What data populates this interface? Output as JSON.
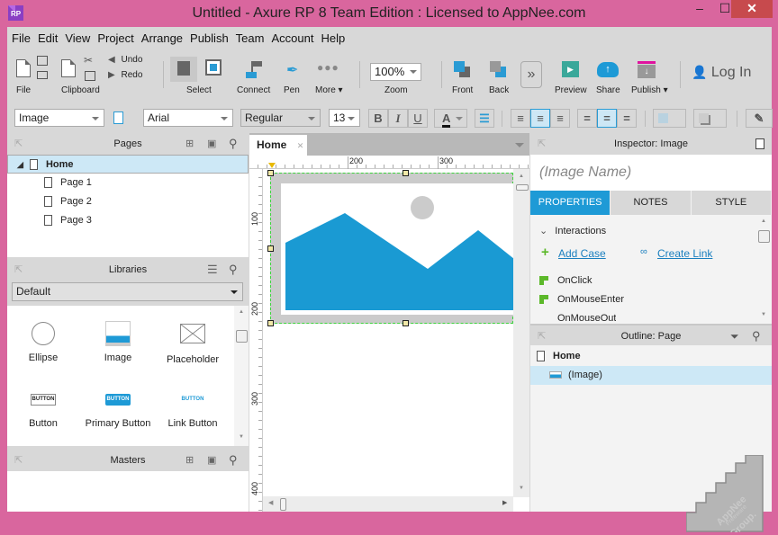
{
  "window": {
    "app_icon": "RP",
    "title": "Untitled - Axure RP 8 Team Edition : Licensed to AppNee.com",
    "minimize": "–",
    "maximize": "☐",
    "close": "✕"
  },
  "menu": [
    "File",
    "Edit",
    "View",
    "Project",
    "Arrange",
    "Publish",
    "Team",
    "Account",
    "Help"
  ],
  "toolbar": {
    "file": "File",
    "clipboard": "Clipboard",
    "undo": "Undo",
    "redo": "Redo",
    "select": "Select",
    "connect": "Connect",
    "pen": "Pen",
    "more": "More ▾",
    "zoom_value": "100%",
    "zoom": "Zoom",
    "front": "Front",
    "back": "Back",
    "overflow": "»",
    "preview": "Preview",
    "share": "Share",
    "publish": "Publish ▾",
    "login": "Log In"
  },
  "formatbar": {
    "style": "Image",
    "font": "Arial",
    "weight": "Regular",
    "size": "13",
    "bold": "B",
    "italic": "I",
    "underline": "U",
    "font_color": "A"
  },
  "pages_panel": {
    "title": "Pages",
    "items": [
      {
        "label": "Home",
        "selected": true
      },
      {
        "label": "Page 1"
      },
      {
        "label": "Page 2"
      },
      {
        "label": "Page 3"
      }
    ]
  },
  "libraries_panel": {
    "title": "Libraries",
    "selected_library": "Default",
    "items": [
      "Ellipse",
      "Image",
      "Placeholder",
      "Button",
      "Primary Button",
      "Link Button"
    ],
    "button_text": "BUTTON"
  },
  "masters_panel": {
    "title": "Masters"
  },
  "canvas": {
    "tab": "Home",
    "tab_close": "✕",
    "ruler_x": [
      "200",
      "300"
    ],
    "ruler_y": [
      "100",
      "200",
      "300",
      "400"
    ]
  },
  "inspector": {
    "title": "Inspector: Image",
    "name_placeholder": "(Image Name)",
    "tabs": [
      "PROPERTIES",
      "NOTES",
      "STYLE"
    ],
    "section": "Interactions",
    "add_case": "Add Case",
    "create_link": "Create Link",
    "events": [
      "OnClick",
      "OnMouseEnter",
      "OnMouseOut"
    ]
  },
  "outline": {
    "title": "Outline: Page",
    "page": "Home",
    "items": [
      "(Image)"
    ]
  },
  "watermark": {
    "line1": "AppNee",
    "line2": "Freeware",
    "line3": "Group."
  },
  "colors": {
    "accent": "#1e9ad6",
    "selection": "#cde8f6",
    "titlebar": "#d9669e",
    "close": "#c74a4d"
  }
}
